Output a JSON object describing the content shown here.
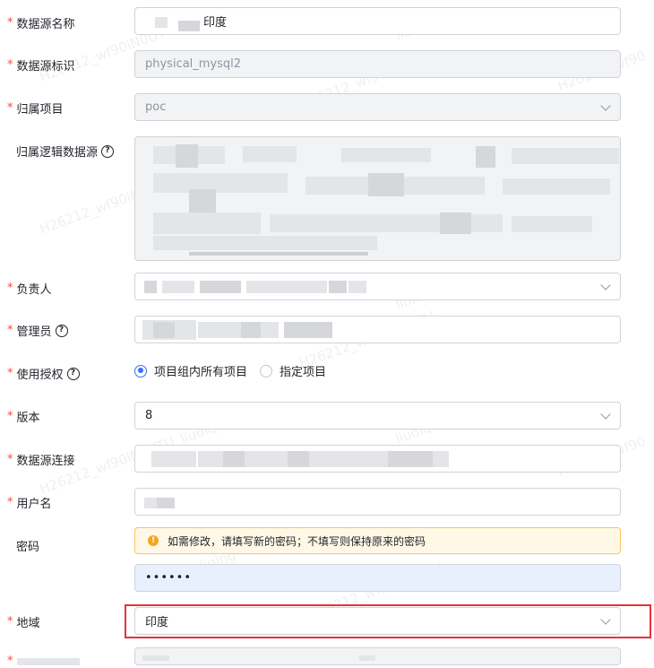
{
  "form": {
    "name": {
      "label": "数据源名称",
      "value": "印度"
    },
    "identifier": {
      "label": "数据源标识",
      "value": "physical_mysql2"
    },
    "project": {
      "label": "归属项目",
      "value": "poc"
    },
    "logical_source": {
      "label": "归属逻辑数据源"
    },
    "owner": {
      "label": "负责人"
    },
    "admin": {
      "label": "管理员"
    },
    "authorization": {
      "label": "使用授权",
      "options": [
        "项目组内所有项目",
        "指定项目"
      ],
      "selected": "项目组内所有项目"
    },
    "version": {
      "label": "版本",
      "value": "8"
    },
    "connection": {
      "label": "数据源连接"
    },
    "username": {
      "label": "用户名"
    },
    "password": {
      "label": "密码",
      "notice": "如需修改，请填写新的密码；不填写则保持原来的密码",
      "value": "••••••"
    },
    "region": {
      "label": "地域",
      "value": "印度"
    }
  },
  "icons": {
    "help": "question-circle-icon",
    "warning": "exclamation-circle-icon",
    "dropdown": "chevron-down-icon"
  },
  "colors": {
    "required": "#f54a45",
    "primary": "#3370ff",
    "highlight": "#e5323d",
    "warning": "#f5a623"
  }
}
